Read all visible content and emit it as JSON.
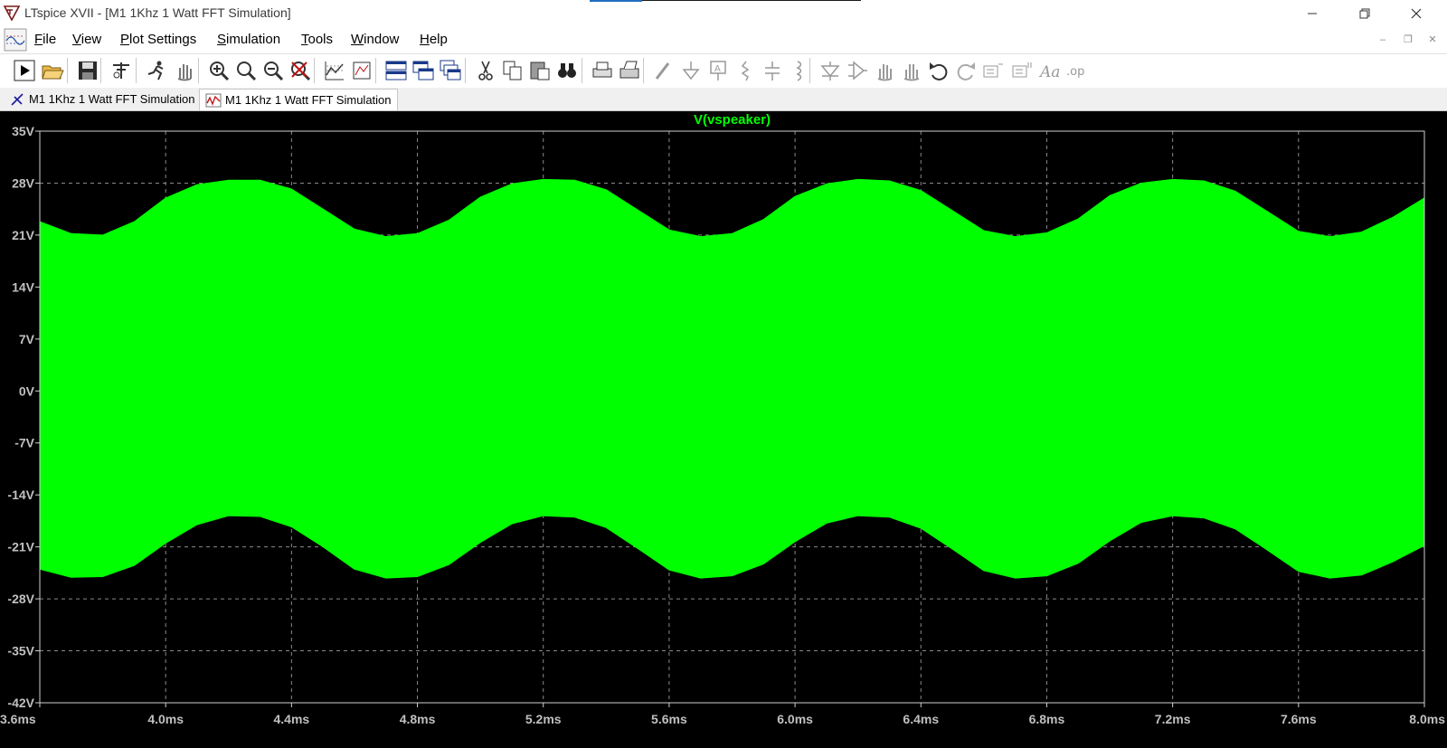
{
  "window": {
    "title": "LTspice XVII - [M1 1Khz 1 Watt FFT Simulation]"
  },
  "menu": {
    "items": [
      {
        "label": "File",
        "accel": "F",
        "rest": "ile"
      },
      {
        "label": "View",
        "accel": "V",
        "rest": "iew"
      },
      {
        "label": "Plot Settings",
        "accel": "P",
        "rest": "lot Settings"
      },
      {
        "label": "Simulation",
        "accel": "S",
        "rest": "imulation"
      },
      {
        "label": "Tools",
        "accel": "T",
        "rest": "ools"
      },
      {
        "label": "Window",
        "accel": "W",
        "rest": "indow"
      },
      {
        "label": "Help",
        "accel": "H",
        "rest": "elp"
      }
    ]
  },
  "toolbar": {
    "icons": [
      "run-icon",
      "open-folder-icon",
      "save-icon",
      "control-panel-icon",
      "halt-icon",
      "pan-icon",
      "zoom-in-icon",
      "zoom-out-icon",
      "zoom-fit-icon",
      "zoom-cancel-icon",
      "autorange-icon",
      "mark-area-icon",
      "tile-horizontal-icon",
      "tile-vertical-icon",
      "cascade-icon",
      "cut-icon",
      "copy-icon",
      "paste-icon",
      "find-icon",
      "print-icon",
      "print-setup-icon",
      "draw-wire-icon",
      "ground-icon",
      "label-net-icon",
      "resistor-icon",
      "capacitor-icon",
      "inductor-icon",
      "diode-icon",
      "component-icon",
      "move-icon",
      "drag-icon",
      "undo-icon",
      "redo-icon",
      "rotate-icon",
      "mirror-icon",
      "text-icon",
      "spice-directive-icon"
    ]
  },
  "tabs": [
    {
      "label": "M1 1Khz 1 Watt FFT Simulation",
      "icon": "schematic-icon",
      "active": false
    },
    {
      "label": "M1 1Khz 1 Watt FFT Simulation",
      "icon": "waveform-icon",
      "active": true
    }
  ],
  "colors": {
    "trace": "#00ff00",
    "background": "#000000",
    "axis_text": "#c0c0c0",
    "grid": "#8a8a8a"
  },
  "chart_data": {
    "type": "area",
    "title": "V(vspeaker)",
    "xlabel": "",
    "ylabel": "",
    "x_ticks": [
      "3.6ms",
      "4.0ms",
      "4.4ms",
      "4.8ms",
      "5.2ms",
      "5.6ms",
      "6.0ms",
      "6.4ms",
      "6.8ms",
      "7.2ms",
      "7.6ms",
      "8.0ms"
    ],
    "y_ticks": [
      "35V",
      "28V",
      "21V",
      "14V",
      "7V",
      "0V",
      "-7V",
      "-14V",
      "-21V",
      "-28V",
      "-35V",
      "-42V"
    ],
    "xlim_ms": [
      3.6,
      8.0
    ],
    "ylim_v": [
      -42,
      35
    ],
    "grid": true,
    "series": [
      {
        "name": "V(vspeaker)",
        "x_ms": [
          3.6,
          3.7,
          3.8,
          3.9,
          4.0,
          4.1,
          4.2,
          4.3,
          4.4,
          4.5,
          4.6,
          4.7,
          4.8,
          4.9,
          5.0,
          5.1,
          5.2,
          5.3,
          5.4,
          5.5,
          5.6,
          5.7,
          5.8,
          5.9,
          6.0,
          6.1,
          6.2,
          6.3,
          6.4,
          6.5,
          6.6,
          6.7,
          6.8,
          6.9,
          7.0,
          7.1,
          7.2,
          7.3,
          7.4,
          7.5,
          7.6,
          7.7,
          7.8,
          7.9,
          8.0
        ],
        "upper_v": [
          22.8,
          21.2,
          21.0,
          22.8,
          26.0,
          27.8,
          28.4,
          28.4,
          27.2,
          24.5,
          21.8,
          20.8,
          21.2,
          23.0,
          26.1,
          27.9,
          28.5,
          28.4,
          27.1,
          24.4,
          21.7,
          20.8,
          21.2,
          23.1,
          26.2,
          27.9,
          28.5,
          28.3,
          27.0,
          24.3,
          21.6,
          20.8,
          21.3,
          23.2,
          26.3,
          28.0,
          28.5,
          28.3,
          26.9,
          24.2,
          21.5,
          20.8,
          21.4,
          23.4,
          26.0
        ],
        "lower_v": [
          -24.0,
          -25.1,
          -25.0,
          -23.5,
          -20.5,
          -18.0,
          -16.8,
          -16.9,
          -18.3,
          -21.0,
          -24.0,
          -25.2,
          -25.0,
          -23.4,
          -20.4,
          -17.9,
          -16.8,
          -17.0,
          -18.4,
          -21.2,
          -24.1,
          -25.2,
          -24.9,
          -23.3,
          -20.3,
          -17.8,
          -16.8,
          -17.0,
          -18.5,
          -21.3,
          -24.2,
          -25.2,
          -24.9,
          -23.2,
          -20.2,
          -17.7,
          -16.8,
          -17.1,
          -18.6,
          -21.4,
          -24.3,
          -25.2,
          -24.8,
          -23.0,
          -20.8
        ]
      }
    ]
  }
}
